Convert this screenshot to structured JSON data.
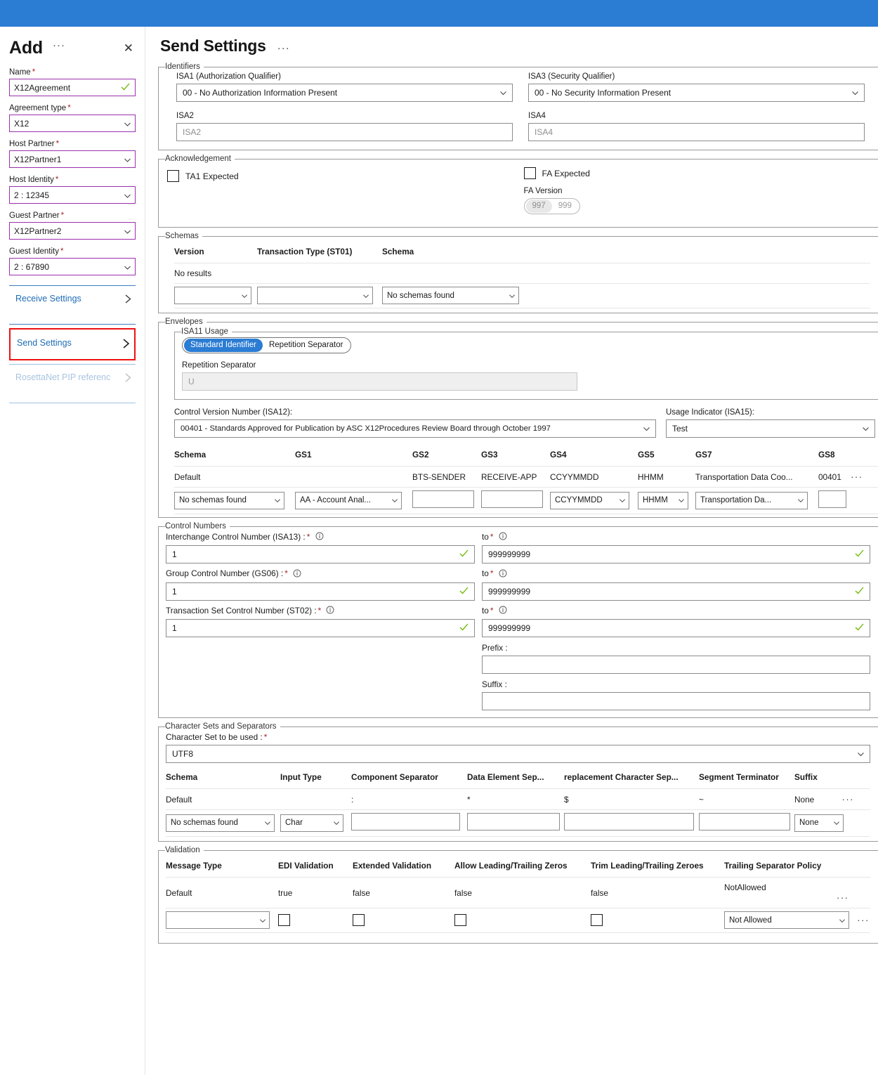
{
  "theme": {
    "accent": "#2b7cd3",
    "highlight": "#ee1111",
    "required": "#a4262c",
    "valid": "#6bb700",
    "field_border": "#9b2fae"
  },
  "blade": {
    "title": "Add",
    "ellipsis": "···",
    "close": "✕",
    "fields": [
      {
        "label": "Name",
        "required": "*",
        "value": "X12Agreement",
        "type": "text-valid"
      },
      {
        "label": "Agreement type",
        "required": "*",
        "value": "X12",
        "type": "select"
      },
      {
        "label": "Host Partner",
        "required": "*",
        "value": "X12Partner1",
        "type": "select"
      },
      {
        "label": "Host Identity",
        "required": "*",
        "value": "2 : 12345",
        "type": "select"
      },
      {
        "label": "Guest Partner",
        "required": "*",
        "value": "X12Partner2",
        "type": "select"
      },
      {
        "label": "Guest Identity",
        "required": "*",
        "value": "2 : 67890",
        "type": "select"
      }
    ],
    "nav": [
      {
        "label": "Receive Settings",
        "state": "normal"
      },
      {
        "label": "Send Settings",
        "state": "selected"
      },
      {
        "label": "RosettaNet PIP referenc",
        "state": "disabled"
      }
    ]
  },
  "main": {
    "title": "Send Settings",
    "ellipsis": "···",
    "identifiers": {
      "legend": "Identifiers",
      "isa1_label": "ISA1 (Authorization Qualifier)",
      "isa1_value": "00 - No Authorization Information Present",
      "isa3_label": "ISA3 (Security Qualifier)",
      "isa3_value": "00 - No Security Information Present",
      "isa2_label": "ISA2",
      "isa2_placeholder": "ISA2",
      "isa4_label": "ISA4",
      "isa4_placeholder": "ISA4"
    },
    "acknowledgement": {
      "legend": "Acknowledgement",
      "ta1_label": "TA1 Expected",
      "ta1_checked": false,
      "fa_label": "FA Expected",
      "fa_checked": false,
      "fa_version_label": "FA Version",
      "fa_version_options": [
        "997",
        "999"
      ],
      "fa_version_selected": "997",
      "fa_version_disabled": true
    },
    "schemas": {
      "legend": "Schemas",
      "columns": [
        "Version",
        "Transaction Type (ST01)",
        "Schema"
      ],
      "empty_text": "No results",
      "row_version": "",
      "row_transaction_type": "",
      "row_schema": "No schemas found"
    },
    "envelopes": {
      "legend": "Envelopes",
      "isa11_label": "ISA11 Usage",
      "isa11_options": [
        "Standard Identifier",
        "Repetition Separator"
      ],
      "isa11_selected": "Standard Identifier",
      "rep_sep_label": "Repetition Separator",
      "rep_sep_value": "U",
      "control_version_label": "Control Version Number (ISA12):",
      "control_version_value": "00401 - Standards Approved for Publication by ASC X12Procedures Review Board through October 1997",
      "usage_indicator_label": "Usage Indicator (ISA15):",
      "usage_indicator_value": "Test",
      "gs_columns": [
        "Schema",
        "GS1",
        "GS2",
        "GS3",
        "GS4",
        "GS5",
        "GS7",
        "GS8"
      ],
      "gs_default_row": [
        "Default",
        "",
        "BTS-SENDER",
        "RECEIVE-APP",
        "CCYYMMDD",
        "HHMM",
        "Transportation Data Coo...",
        "00401"
      ],
      "gs_edit_row": {
        "schema": "No schemas found",
        "gs1": "AA - Account Anal...",
        "gs2": "",
        "gs3": "",
        "gs4": "CCYYMMDD",
        "gs5": "HHMM",
        "gs7": "Transportation Da...",
        "gs8": ""
      },
      "row_menu": "···"
    },
    "control_numbers": {
      "legend": "Control Numbers",
      "to_label": "to",
      "prefix_label": "Prefix :",
      "prefix_value": "",
      "suffix_label": "Suffix :",
      "suffix_value": "",
      "rows": [
        {
          "label": "Interchange Control Number (ISA13) :",
          "from": "1",
          "to": "999999999"
        },
        {
          "label": "Group Control Number (GS06) :",
          "from": "1",
          "to": "999999999"
        },
        {
          "label": "Transaction Set Control Number (ST02) :",
          "from": "1",
          "to": "999999999"
        }
      ]
    },
    "charsets": {
      "legend": "Character Sets and Separators",
      "charset_label": "Character Set to be used :",
      "charset_value": "UTF8",
      "columns": [
        "Schema",
        "Input Type",
        "Component Separator",
        "Data Element Sep...",
        "replacement Character Sep...",
        "Segment Terminator",
        "Suffix"
      ],
      "default_row": [
        "Default",
        "",
        ":",
        "*",
        "$",
        "~",
        "None"
      ],
      "edit_row": {
        "schema": "No schemas found",
        "input_type": "Char",
        "component_separator": "",
        "data_element_separator": "",
        "replacement_char_separator": "",
        "segment_terminator": "",
        "suffix": "None"
      },
      "row_menu": "···"
    },
    "validation": {
      "legend": "Validation",
      "columns": [
        "Message Type",
        "EDI Validation",
        "Extended Validation",
        "Allow Leading/Trailing Zeros",
        "Trim Leading/Trailing Zeroes",
        "Trailing Separator Policy"
      ],
      "default_row": [
        "Default",
        "true",
        "false",
        "false",
        "false",
        "NotAllowed"
      ],
      "edit_row": {
        "message_type": "",
        "edi_validation": false,
        "extended_validation": false,
        "allow_leading_trailing_zeros": false,
        "trim_leading_trailing_zeroes": false,
        "trailing_separator_policy": "Not Allowed"
      },
      "row_menu": "···"
    }
  }
}
